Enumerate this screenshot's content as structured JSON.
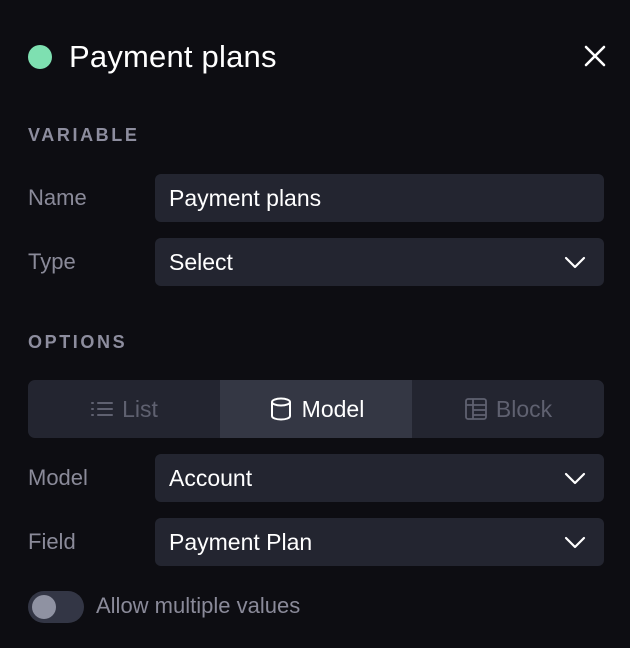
{
  "header": {
    "title": "Payment plans",
    "status_color": "#7ee0b1",
    "close_icon": "close-icon"
  },
  "variable_section": {
    "label": "VARIABLE",
    "name_label": "Name",
    "name_value": "Payment plans",
    "type_label": "Type",
    "type_value": "Select"
  },
  "options_section": {
    "label": "OPTIONS",
    "tabs": [
      {
        "label": "List",
        "icon": "list-icon",
        "active": false
      },
      {
        "label": "Model",
        "icon": "database-icon",
        "active": true
      },
      {
        "label": "Block",
        "icon": "table-icon",
        "active": false
      }
    ],
    "model_label": "Model",
    "model_value": "Account",
    "field_label": "Field",
    "field_value": "Payment Plan"
  },
  "allow_multiple": {
    "label": "Allow multiple values",
    "enabled": false
  }
}
